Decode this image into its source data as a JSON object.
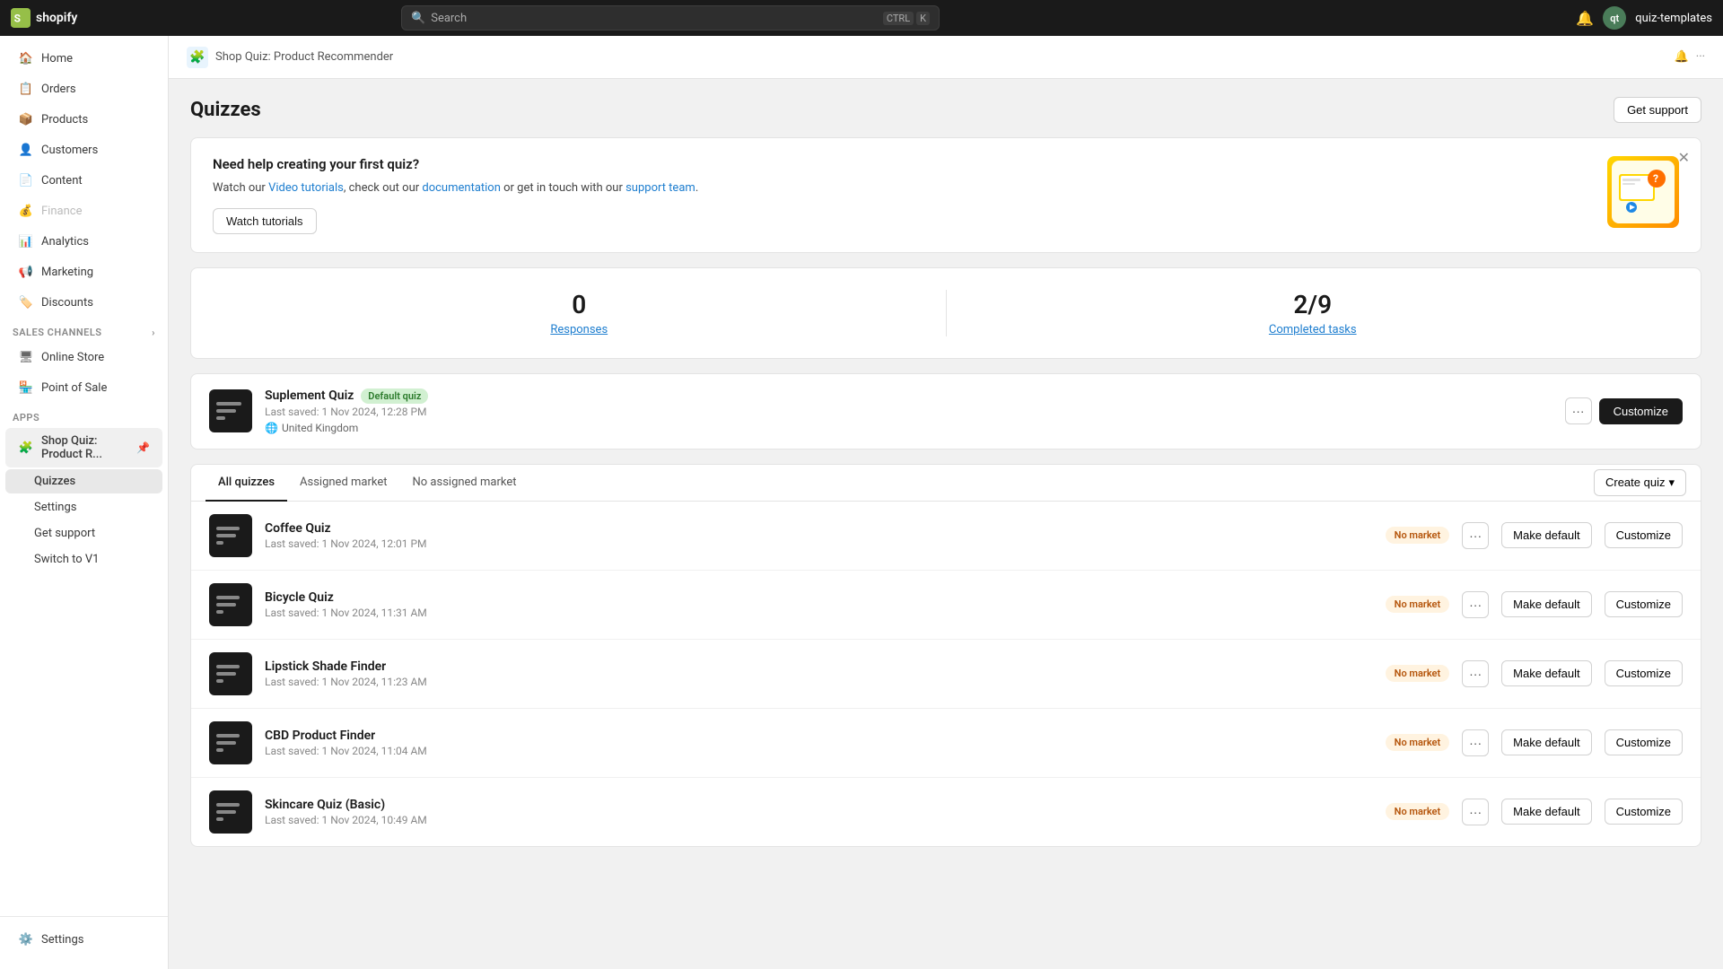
{
  "topnav": {
    "logo_text": "shopify",
    "search_placeholder": "Search",
    "search_shortcut_ctrl": "CTRL",
    "search_shortcut_k": "K",
    "username": "quiz-templates"
  },
  "sidebar": {
    "nav_items": [
      {
        "id": "home",
        "label": "Home",
        "icon": "home"
      },
      {
        "id": "orders",
        "label": "Orders",
        "icon": "orders"
      },
      {
        "id": "products",
        "label": "Products",
        "icon": "products"
      },
      {
        "id": "customers",
        "label": "Customers",
        "icon": "customers"
      },
      {
        "id": "content",
        "label": "Content",
        "icon": "content"
      },
      {
        "id": "finance",
        "label": "Finance",
        "icon": "finance",
        "disabled": true
      },
      {
        "id": "analytics",
        "label": "Analytics",
        "icon": "analytics"
      },
      {
        "id": "marketing",
        "label": "Marketing",
        "icon": "marketing"
      },
      {
        "id": "discounts",
        "label": "Discounts",
        "icon": "discounts"
      }
    ],
    "sales_channels_label": "Sales channels",
    "sales_channels": [
      {
        "id": "online-store",
        "label": "Online Store",
        "icon": "store"
      },
      {
        "id": "point-of-sale",
        "label": "Point of Sale",
        "icon": "pos"
      }
    ],
    "apps_label": "Apps",
    "apps": [
      {
        "id": "shop-quiz",
        "label": "Shop Quiz: Product R...",
        "icon": "quiz",
        "active": true
      }
    ],
    "sub_items": [
      {
        "id": "quizzes",
        "label": "Quizzes",
        "active": true
      },
      {
        "id": "settings",
        "label": "Settings"
      },
      {
        "id": "get-support",
        "label": "Get support"
      },
      {
        "id": "switch-to-v1",
        "label": "Switch to V1"
      }
    ],
    "settings_label": "Settings"
  },
  "app_header": {
    "icon": "🧩",
    "title": "Shop Quiz: Product Recommender"
  },
  "page": {
    "title": "Quizzes",
    "get_support_label": "Get support"
  },
  "help_banner": {
    "title": "Need help creating your first quiz?",
    "text_before_link1": "Watch our ",
    "link1_text": "Video tutorials",
    "text_between": ", check out our ",
    "link2_text": "documentation",
    "text_before_link3": " or get in touch with our ",
    "link3_text": "support team",
    "text_after": ".",
    "watch_btn": "Watch tutorials",
    "close_title": "Close"
  },
  "stats": {
    "responses_value": "0",
    "responses_label": "Responses",
    "completed_tasks_value": "2/9",
    "completed_tasks_label": "Completed tasks"
  },
  "featured_quiz": {
    "name": "Suplement Quiz",
    "badge": "Default quiz",
    "last_saved": "Last saved: 1 Nov 2024, 12:28 PM",
    "market": "United Kingdom",
    "more_btn": "···",
    "customize_btn": "Customize"
  },
  "quiz_list": {
    "tabs": [
      {
        "id": "all",
        "label": "All quizzes",
        "active": true
      },
      {
        "id": "assigned",
        "label": "Assigned market"
      },
      {
        "id": "no-assigned",
        "label": "No assigned market"
      }
    ],
    "create_btn": "Create quiz",
    "items": [
      {
        "id": "coffee-quiz",
        "name": "Coffee Quiz",
        "last_saved": "Last saved: 1 Nov 2024, 12:01 PM",
        "market_badge": "No market",
        "make_default_btn": "Make default",
        "customize_btn": "Customize"
      },
      {
        "id": "bicycle-quiz",
        "name": "Bicycle Quiz",
        "last_saved": "Last saved: 1 Nov 2024, 11:31 AM",
        "market_badge": "No market",
        "make_default_btn": "Make default",
        "customize_btn": "Customize"
      },
      {
        "id": "lipstick-shade-finder",
        "name": "Lipstick Shade Finder",
        "last_saved": "Last saved: 1 Nov 2024, 11:23 AM",
        "market_badge": "No market",
        "make_default_btn": "Make default",
        "customize_btn": "Customize"
      },
      {
        "id": "cbd-product-finder",
        "name": "CBD Product Finder",
        "last_saved": "Last saved: 1 Nov 2024, 11:04 AM",
        "market_badge": "No market",
        "make_default_btn": "Make default",
        "customize_btn": "Customize"
      },
      {
        "id": "skincare-quiz-basic",
        "name": "Skincare Quiz (Basic)",
        "last_saved": "Last saved: 1 Nov 2024, 10:49 AM",
        "market_badge": "No market",
        "make_default_btn": "Make default",
        "customize_btn": "Customize"
      }
    ]
  }
}
